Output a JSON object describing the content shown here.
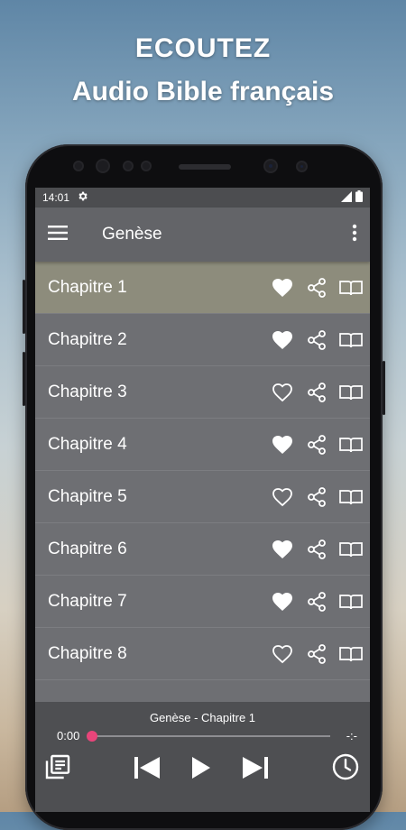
{
  "promo": {
    "line1": "ECOUTEZ",
    "line2": "Audio Bible français"
  },
  "statusbar": {
    "time": "14:01"
  },
  "toolbar": {
    "title": "Genèse"
  },
  "chapters": [
    {
      "label": "Chapitre 1",
      "favorite": true,
      "active": true
    },
    {
      "label": "Chapitre 2",
      "favorite": true
    },
    {
      "label": "Chapitre 3",
      "favorite": false
    },
    {
      "label": "Chapitre 4",
      "favorite": true
    },
    {
      "label": "Chapitre 5",
      "favorite": false
    },
    {
      "label": "Chapitre 6",
      "favorite": true
    },
    {
      "label": "Chapitre 7",
      "favorite": true
    },
    {
      "label": "Chapitre 8",
      "favorite": false
    }
  ],
  "player": {
    "track": "Genèse - Chapitre 1",
    "elapsed": "0:00",
    "remaining": "-:-",
    "progress": 0
  },
  "colors": {
    "accent": "#e8457a",
    "active_row": "#8d8c7c",
    "list_bg": "#6e6f73",
    "toolbar": "#636468"
  },
  "icons": [
    "menu-icon",
    "more-vert-icon",
    "heart-icon",
    "share-icon",
    "book-icon",
    "playlist-icon",
    "skip-previous-icon",
    "play-icon",
    "skip-next-icon",
    "clock-icon",
    "gear-icon",
    "signal-icon",
    "battery-icon"
  ]
}
